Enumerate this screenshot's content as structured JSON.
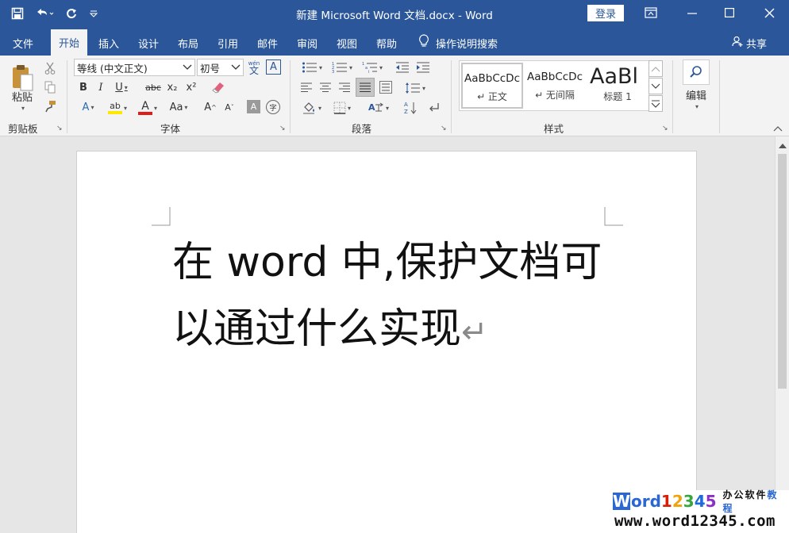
{
  "titlebar": {
    "title": "新建 Microsoft Word 文档.docx  -  Word",
    "login_label": "登录",
    "qat": {
      "save_icon": "save-icon",
      "undo_icon": "undo-icon",
      "redo_icon": "redo-icon",
      "customize_icon": "customize-icon"
    },
    "window_controls": {
      "ribbon_display_icon": "ribbon-display-icon",
      "minimize_icon": "minimize-icon",
      "maximize_icon": "maximize-icon",
      "close_icon": "close-icon"
    }
  },
  "tabs": [
    {
      "label": "文件"
    },
    {
      "label": "开始"
    },
    {
      "label": "插入"
    },
    {
      "label": "设计"
    },
    {
      "label": "布局"
    },
    {
      "label": "引用"
    },
    {
      "label": "邮件"
    },
    {
      "label": "审阅"
    },
    {
      "label": "视图"
    },
    {
      "label": "帮助"
    }
  ],
  "active_tab": "开始",
  "tell_me": {
    "label": "操作说明搜索",
    "icon": "lightbulb-icon"
  },
  "share": {
    "label": "共享",
    "icon": "person-icon"
  },
  "ribbon": {
    "clipboard": {
      "label": "剪贴板",
      "paste_label": "粘贴"
    },
    "font": {
      "label": "字体",
      "font_name": "等线 (中文正文)",
      "font_size": "初号",
      "phonetic_glyph": "文",
      "phonetic_top": "wén",
      "border_glyph": "A",
      "bold": "B",
      "italic": "I",
      "underline": "U",
      "strike": "abc",
      "subscript": "x₂",
      "superscript": "x²",
      "effects": "A",
      "highlight": "ab",
      "font_color": "A",
      "change_case": "Aa",
      "grow": "A",
      "shrink": "A",
      "shading": "A",
      "enclose": "字"
    },
    "paragraph": {
      "label": "段落"
    },
    "styles": {
      "label": "样式",
      "items": [
        {
          "preview": "AaBbCcDc",
          "name": "↵ 正文"
        },
        {
          "preview": "AaBbCcDc",
          "name": "↵ 无间隔"
        },
        {
          "preview": "AaBl",
          "name": "标题 1"
        }
      ]
    },
    "editing": {
      "label": "编辑"
    }
  },
  "document": {
    "text": "在 word 中,保护文档可以通过什么实现",
    "paragraph_mark": "↵"
  },
  "watermark": {
    "w": "W",
    "ord": "ord",
    "digits": [
      "1",
      "2",
      "3",
      "4",
      "5"
    ],
    "digit_colors": [
      "#d81e06",
      "#f0a30a",
      "#37a63d",
      "#1e6bd8",
      "#8b2fc9"
    ],
    "ord_color": "#2a67d2",
    "subtitle_a": "办公软件",
    "subtitle_b": "教程",
    "subtitle_b_color": "#2a67d2",
    "url": "www.word12345.com"
  }
}
